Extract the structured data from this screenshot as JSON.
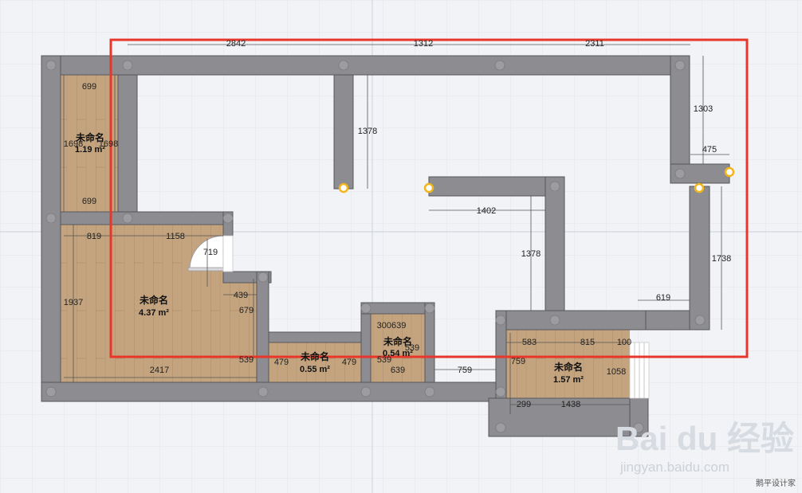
{
  "colors": {
    "background": "#f2f3f6",
    "grid": "#e2e4ea",
    "wall": "#8d8d91",
    "wall_edge": "#57575b",
    "floor": "#c3a47f",
    "selection": "#e8372a",
    "handle": "#f2b51b"
  },
  "rooms": [
    {
      "id": "room-a",
      "name": "未命名",
      "area": "1.19 m²"
    },
    {
      "id": "room-b",
      "name": "未命名",
      "area": "4.37 m²"
    },
    {
      "id": "room-c",
      "name": "未命名",
      "area": "0.55 m²"
    },
    {
      "id": "room-d",
      "name": "未命名",
      "area": "0.54 m²"
    },
    {
      "id": "room-e",
      "name": "未命名",
      "area": "1.57 m²"
    }
  ],
  "dimensions": {
    "top_1": "2842",
    "top_2": "1312",
    "top_3": "2311",
    "right_upper": "1303",
    "right_stub": "475",
    "right_lower": "1738",
    "inner_vertical": "1378",
    "inner_horizontal": "1402",
    "inner_vertical_2": "1378",
    "bottom_right_left": "619",
    "roomA_top": "699",
    "roomA_bottom": "699",
    "roomA_left": "1698",
    "roomA_right": "1698",
    "roomB_top_left": "819",
    "roomB_top_right": "1158",
    "roomB_door": "719",
    "roomB_left": "1937",
    "roomB_step": "439",
    "roomB_right": "679",
    "roomB_bottom": "2417",
    "roomB_corner": "539",
    "roomC_left": "479",
    "roomC_right": "479",
    "roomD_top": "300639",
    "roomD_right": "539",
    "roomD_bottom_left": "539",
    "roomD_bottom": "639",
    "corridor": "759",
    "roomE_top_left": "583",
    "roomE_top_right": "815",
    "roomE_top_end": "100",
    "roomE_left": "759",
    "roomE_right": "1058",
    "roomE_bottom_left": "299",
    "roomE_bottom": "1438"
  },
  "watermark": {
    "logo": "Bai du 经验",
    "url": "jingyan.baidu.com"
  },
  "credit": "鹅平设计家"
}
